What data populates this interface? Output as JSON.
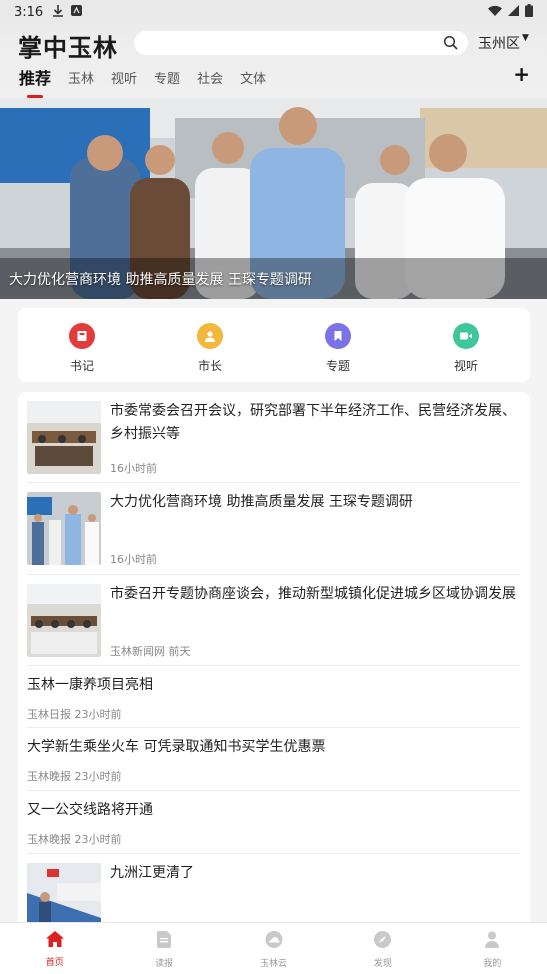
{
  "status_bar": {
    "time": "3:16"
  },
  "header": {
    "logo": "掌中玉林",
    "search_placeholder": "",
    "region": "玉州区",
    "tabs": [
      "推荐",
      "玉林",
      "视听",
      "专题",
      "社会",
      "文体"
    ],
    "active_tab": 0,
    "plus": "+"
  },
  "banner": {
    "caption": "大力优化营商环境 助推高质量发展 王琛专题调研"
  },
  "quick_menu": [
    {
      "label": "书记",
      "color": "#e23b3b",
      "icon": "book-icon"
    },
    {
      "label": "市长",
      "color": "#f3b73c",
      "icon": "person-icon"
    },
    {
      "label": "专题",
      "color": "#7a72e6",
      "icon": "bookmark-icon"
    },
    {
      "label": "视听",
      "color": "#3ec79a",
      "icon": "video-icon"
    }
  ],
  "news": [
    {
      "title": "市委常委会召开会议，研究部署下半年经济工作、民营经济发展、乡村振兴等",
      "source": "",
      "time": "16小时前",
      "thumb": "meeting"
    },
    {
      "title": "大力优化营商环境 助推高质量发展 王琛专题调研",
      "source": "",
      "time": "16小时前",
      "thumb": "visit"
    },
    {
      "title": "市委召开专题协商座谈会，推动新型城镇化促进城乡区域协调发展",
      "source": "玉林新闻网",
      "time": "前天",
      "thumb": "meeting"
    },
    {
      "title": "玉林一康养项目亮相",
      "source": "玉林日报",
      "time": "23小时前"
    },
    {
      "title": "大学新生乘坐火车 可凭录取通知书买学生优惠票",
      "source": "玉林晚报",
      "time": "23小时前"
    },
    {
      "title": "又一公交线路将开通",
      "source": "玉林晚报",
      "time": "23小时前"
    },
    {
      "title": "九洲江更清了",
      "source": "",
      "time": "",
      "thumb": "river"
    }
  ],
  "bottom_nav": [
    {
      "label": "首页",
      "icon": "home-icon"
    },
    {
      "label": "读报",
      "icon": "newspaper-icon"
    },
    {
      "label": "玉林云",
      "icon": "cloud-icon"
    },
    {
      "label": "发现",
      "icon": "discover-icon"
    },
    {
      "label": "我的",
      "icon": "user-icon"
    }
  ],
  "colors": {
    "accent": "#e02020",
    "background": "#f4f4f4"
  }
}
